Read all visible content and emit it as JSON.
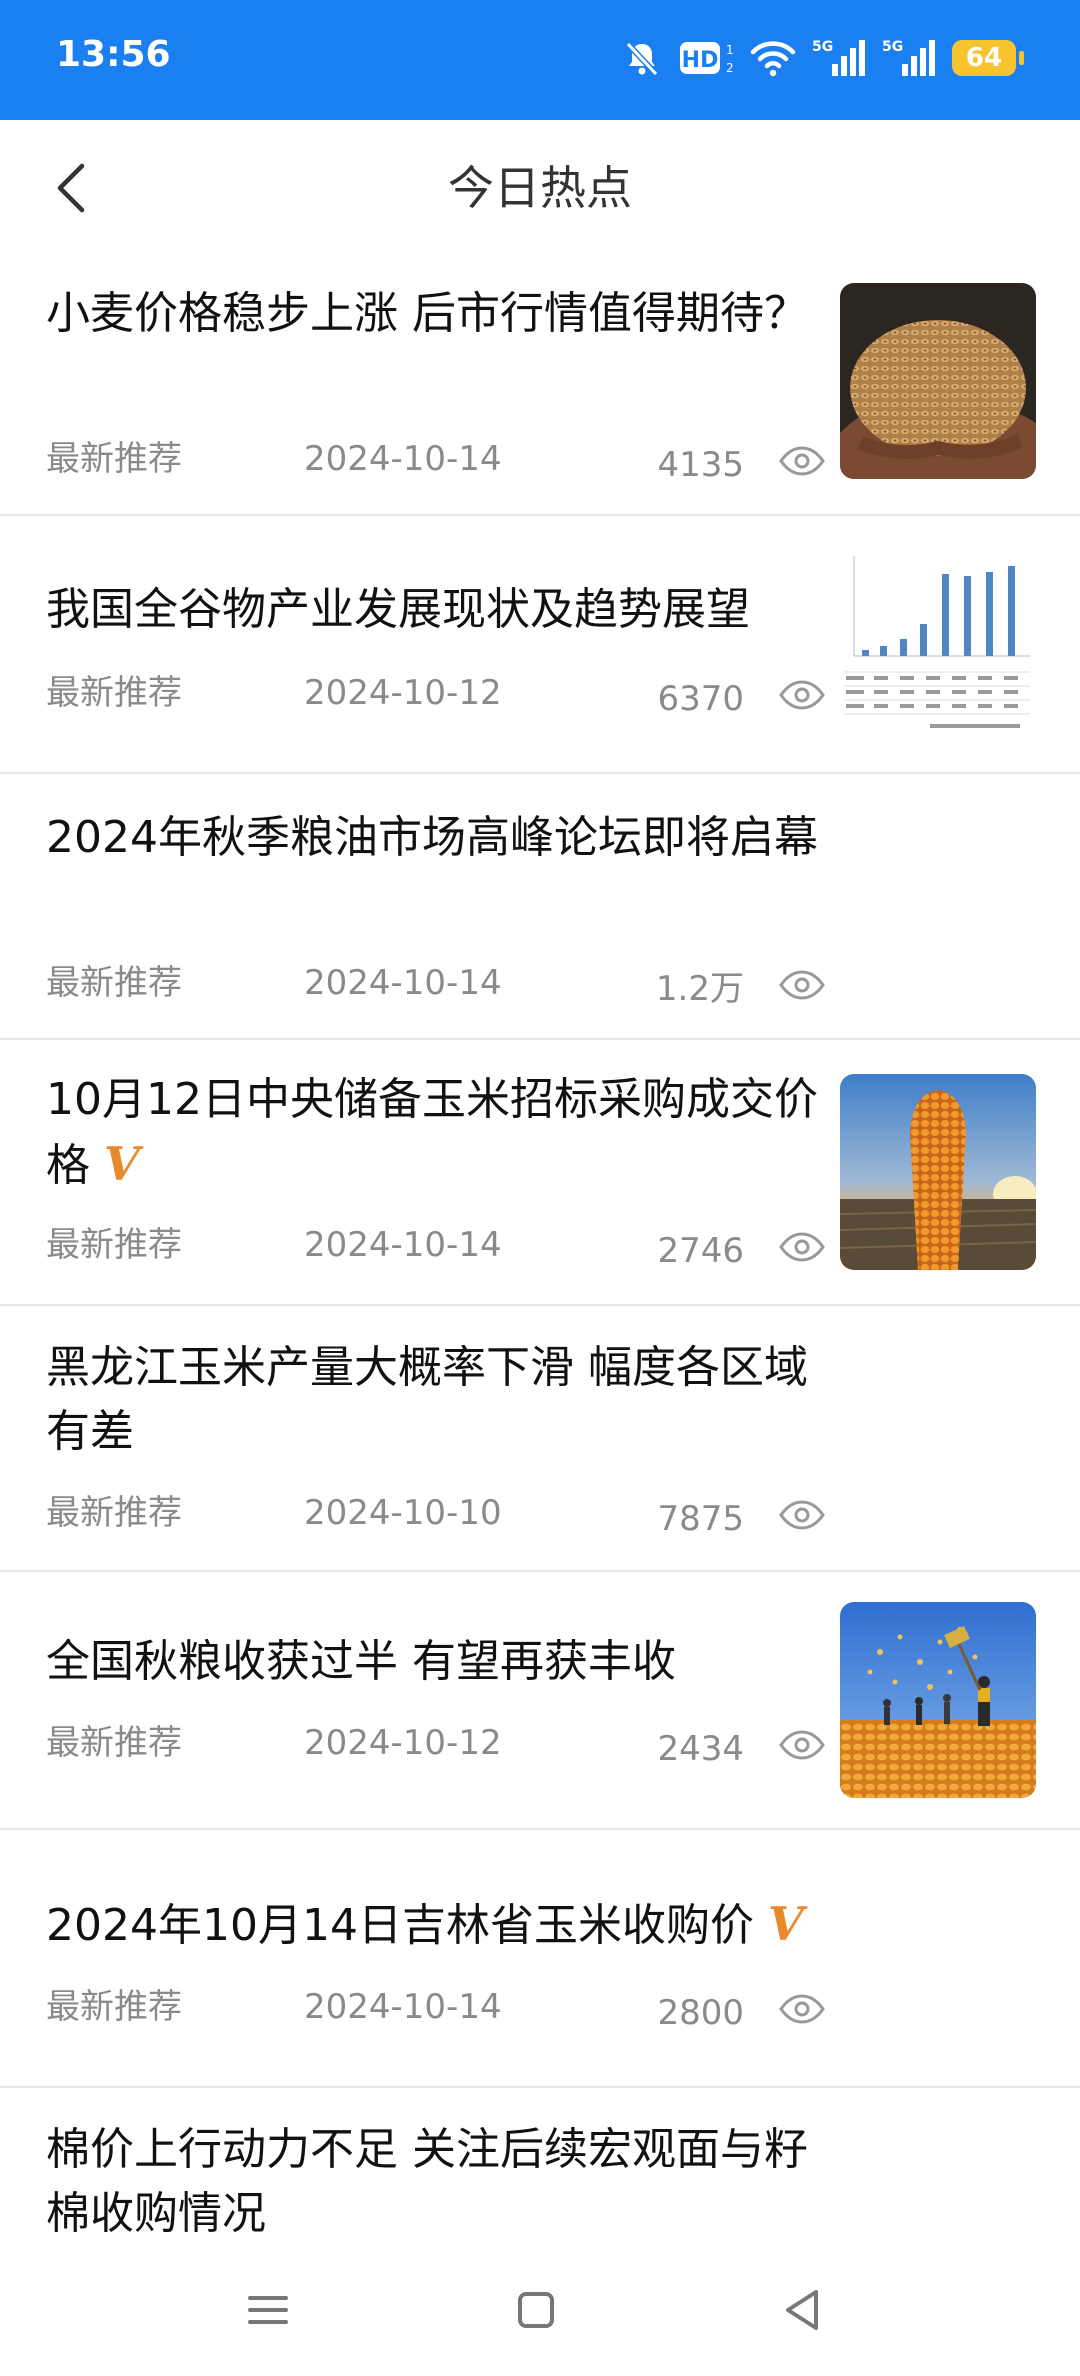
{
  "status_bar": {
    "time": "13:56",
    "battery": "64",
    "signal_label_1": "5G",
    "signal_label_2": "5G",
    "hd_label": "HD"
  },
  "header": {
    "title": "今日热点"
  },
  "news": [
    {
      "title": "小麦价格稳步上涨 后市行情值得期待？",
      "tag": "最新推荐",
      "date": "2024-10-14",
      "views": "4135",
      "vip": false,
      "thumbnail": "wheat-grain-photo"
    },
    {
      "title": "我国全谷物产业发展现状及趋势展望",
      "tag": "最新推荐",
      "date": "2024-10-12",
      "views": "6370",
      "vip": false,
      "thumbnail": "bar-chart-image"
    },
    {
      "title": "2024年秋季粮油市场高峰论坛即将启幕",
      "tag": "最新推荐",
      "date": "2024-10-14",
      "views": "1.2万",
      "vip": false,
      "thumbnail": null
    },
    {
      "title": "10月12日中央储备玉米招标采购成交价格",
      "tag": "最新推荐",
      "date": "2024-10-14",
      "views": "2746",
      "vip": true,
      "vip_label": "V",
      "thumbnail": "corn-cob-sunset-photo"
    },
    {
      "title": "黑龙江玉米产量大概率下滑 幅度各区域有差",
      "tag": "最新推荐",
      "date": "2024-10-10",
      "views": "7875",
      "vip": false,
      "thumbnail": null
    },
    {
      "title": "全国秋粮收获过半 有望再获丰收",
      "tag": "最新推荐",
      "date": "2024-10-12",
      "views": "2434",
      "vip": false,
      "thumbnail": "harvest-field-photo"
    },
    {
      "title": "2024年10月14日吉林省玉米收购价",
      "tag": "最新推荐",
      "date": "2024-10-14",
      "views": "2800",
      "vip": true,
      "vip_label": "V",
      "thumbnail": null
    },
    {
      "title": "棉价上行动力不足 关注后续宏观面与籽棉收购情况",
      "tag": "",
      "date": "",
      "views": "",
      "vip": false,
      "thumbnail": null
    }
  ],
  "colors": {
    "status_bar": "#1a7ff0",
    "vip": "#e8892b",
    "meta_text": "#8a8a8a"
  },
  "icons": {
    "back": "chevron-left-icon",
    "views": "eye-icon",
    "nav": [
      "menu-icon",
      "home-square-icon",
      "back-triangle-icon"
    ]
  }
}
